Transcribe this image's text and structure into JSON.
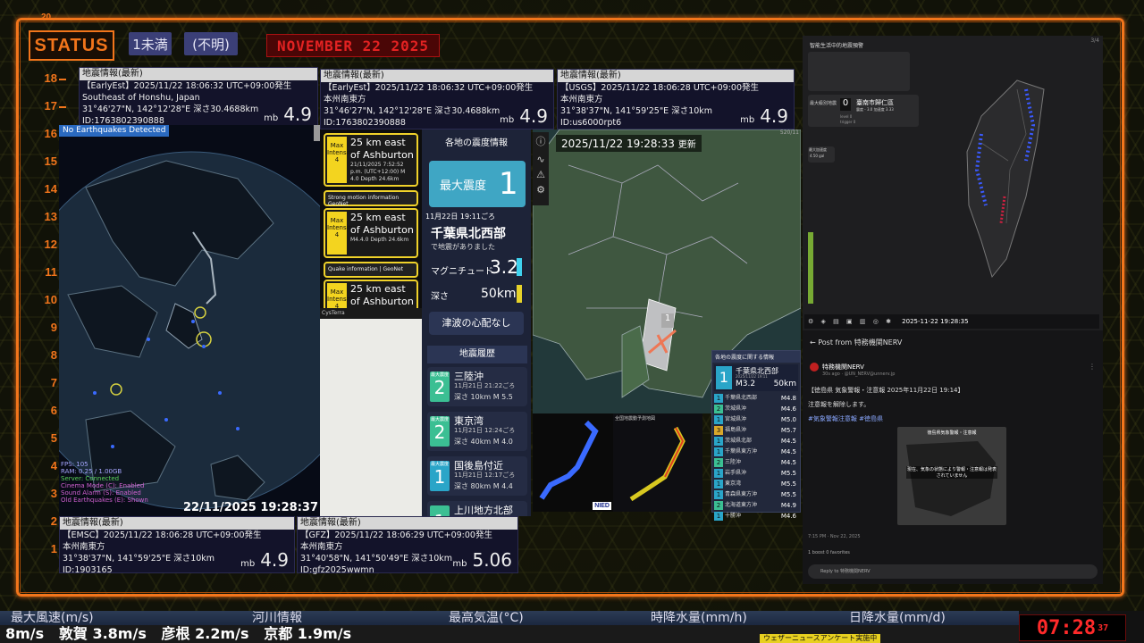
{
  "header": {
    "status": "STATUS",
    "chip1": "1未満",
    "chip2": "(不明)",
    "date": "NOVEMBER 22  2025",
    "top_num": "20"
  },
  "levels": [
    "18",
    "17",
    "16",
    "15",
    "14",
    "13",
    "12",
    "11",
    "10",
    "9",
    "8",
    "7",
    "6",
    "5",
    "4",
    "3",
    "2",
    "1"
  ],
  "eq_boxes": [
    {
      "title": "地震情報(最新)",
      "l1": "【EarlyEst】2025/11/22 18:06:32 UTC+09:00発生",
      "l2": "Southeast of Honshu, Japan",
      "l3": "31°46'27\"N, 142°12'28\"E 深さ30.4688km",
      "l4": "ID:1763802390888",
      "mb": "mb",
      "mag": "4.9"
    },
    {
      "title": "地震情報(最新)",
      "l1": "【EarlyEst】2025/11/22 18:06:32 UTC+09:00発生",
      "l2": "本州南東方",
      "l3": "31°46'27\"N, 142°12'28\"E 深さ30.4688km",
      "l4": "ID:1763802390888",
      "mb": "mb",
      "mag": "4.9"
    },
    {
      "title": "地震情報(最新)",
      "l1": "【USGS】2025/11/22 18:06:28 UTC+09:00発生",
      "l2": "本州南東方",
      "l3": "31°38'37\"N, 141°59'25\"E 深さ10km",
      "l4": "ID:us6000rpt6",
      "mb": "mb",
      "mag": "4.9"
    },
    {
      "title": "地震情報(最新)",
      "l1": "【EMSC】2025/11/22 18:06:28 UTC+09:00発生",
      "l2": "本州南東方",
      "l3": "31°38'37\"N, 141°59'25\"E 深さ10km",
      "l4": "ID:1903165",
      "mb": "mb",
      "mag": "4.9"
    },
    {
      "title": "地震情報(最新)",
      "l1": "【GFZ】2025/11/22 18:06:29 UTC+09:00発生",
      "l2": "本州南東方",
      "l3": "31°40'58\"N, 141°50'49\"E 深さ10km",
      "l4": "ID:gfz2025wwmn",
      "mb": "mb",
      "mag": "5.06"
    }
  ],
  "globe": {
    "badge": "No Earthquakes Detected",
    "timestamp": "22/11/2025 19:28:37",
    "stats": [
      "FPS: 105",
      "RAM: 0.25 / 1.00GB",
      "Server: Connected",
      "Cinema Mode (C): Enabled",
      "Sound Alarm (S): Enabled",
      "Old Earthquakes (E): Shown"
    ]
  },
  "yellow_cards": [
    {
      "place": "25 km east of Ashburton",
      "icon": "Max Intensity 4",
      "meta": "21/11/2025 7:52:52 p.m. (UTC+12:00) M 4.0 Depth 24.6km"
    },
    {
      "head": "Strong motion information GeoNet",
      "place": "25 km east of Ashburton",
      "icon": "Max Intensity 4",
      "meta": "M4.4.0 Depth 24.6km"
    },
    {
      "head": "Quake information | GeoNet",
      "place": "25 km east of Ashburton",
      "icon": "Max Intensity 4",
      "meta": ""
    }
  ],
  "map_app": {
    "label": "CysTerra"
  },
  "intensity": {
    "header": "各地の震度情報",
    "max_label": "最大震度",
    "max_val": "1",
    "date": "11月22日 19:11ごろ",
    "place": "千葉県北西部",
    "sub": "で地震がありました",
    "mag_label": "マグニチュード",
    "mag": "3.2",
    "depth_label": "深さ",
    "depth": "50km",
    "tsunami": "津波の心配なし",
    "hist_title": "地震履歴",
    "history": [
      {
        "n": "2",
        "nl": "最大震度",
        "place": "三陸沖",
        "time": "11月21日 21:22ごろ",
        "detail": "深さ 10km  M 5.5"
      },
      {
        "n": "2",
        "nl": "最大震度",
        "place": "東京湾",
        "time": "11月21日 12:24ごろ",
        "detail": "深さ 40km  M 4.0"
      },
      {
        "n": "1",
        "nl": "最大震度",
        "place": "国後島付近",
        "time": "11月21日 12:17ごろ",
        "detail": "深さ 80km  M 4.4"
      },
      {
        "n": "1",
        "nl": "",
        "place": "上川地方北部",
        "time": "",
        "detail": ""
      }
    ]
  },
  "kanto": {
    "timestamp": "2025/11/22  19:28:33",
    "updated": "更新",
    "scale": "1",
    "corner": "520/11"
  },
  "mini": {
    "nied": "NIED",
    "title": "全国地震動予測地図"
  },
  "hist_panel": {
    "title": "各地の震度に関する情報",
    "max": "1",
    "place": "千葉県北西部",
    "date": "2025/11/22 19:11",
    "mag": "M3.2",
    "depth": "50km",
    "rows": [
      {
        "c": "1",
        "nm": "千葉県北西部",
        "mg": "M4.8"
      },
      {
        "c": "2",
        "nm": "茨城県沖",
        "mg": "M4.6"
      },
      {
        "c": "1",
        "nm": "宮城県沖",
        "mg": "M5.0"
      },
      {
        "c": "3",
        "nm": "福島県沖",
        "mg": "M5.7"
      },
      {
        "c": "1",
        "nm": "茨城県北部",
        "mg": "M4.5"
      },
      {
        "c": "1",
        "nm": "千葉県東方沖",
        "mg": "M4.5"
      },
      {
        "c": "2",
        "nm": "三陸沖",
        "mg": "M4.5"
      },
      {
        "c": "1",
        "nm": "岩手県沖",
        "mg": "M5.5"
      },
      {
        "c": "1",
        "nm": "東京湾",
        "mg": "M5.5"
      },
      {
        "c": "1",
        "nm": "青森県東方沖",
        "mg": "M5.5"
      },
      {
        "c": "2",
        "nm": "北海道東方沖",
        "mg": "M4.9"
      },
      {
        "c": "1",
        "nm": "十勝沖",
        "mg": "M4.6"
      }
    ]
  },
  "taiwan": {
    "title": "智能生活中的地震預警",
    "max_label": "最大級別地震",
    "zero": "0",
    "city": "臺南市歸仁區",
    "line": "震度 - 3.0   加速度 3.33",
    "level": "level",
    "trigger": "trigger",
    "lvl_val": "0",
    "trg_val": "0",
    "pga_label": "最大加速度",
    "pga": "4.50 gal",
    "time": "2025-11-22 19:28:35",
    "frames": "3/4"
  },
  "post": {
    "back": "Post from 特務機関NERV",
    "name": "特務機関NERV",
    "handle": "30s ago · @UN_NERV@unnerv.jp",
    "body1": "【徳島県 気象警報・注意報 2025年11月22日 19:14】",
    "body2": "注意報を解除します。",
    "tags": "#気象警報注意報 #徳島県",
    "card_title": "徳島県気象警報・注意報",
    "card_text": "現在、気象の状態により警報・注意報は発表されていません",
    "time": "7:15 PM · Nov 22, 2025",
    "stats": "1 boost  0 favorites",
    "reply": "Reply to 特務機関NERV"
  },
  "ticker": {
    "row1": [
      "最大風速(m/s)",
      "河川情報",
      "最高気温(°C)",
      "時降水量(mm/h)",
      "日降水量(mm/d)"
    ],
    "row2": "8m/s   敦賀 3.8m/s   彦根 2.2m/s   京都 1.9m/s",
    "banner": "ウェザーニュースアンケート実施中",
    "clock": "07:28",
    "sec": "37"
  }
}
